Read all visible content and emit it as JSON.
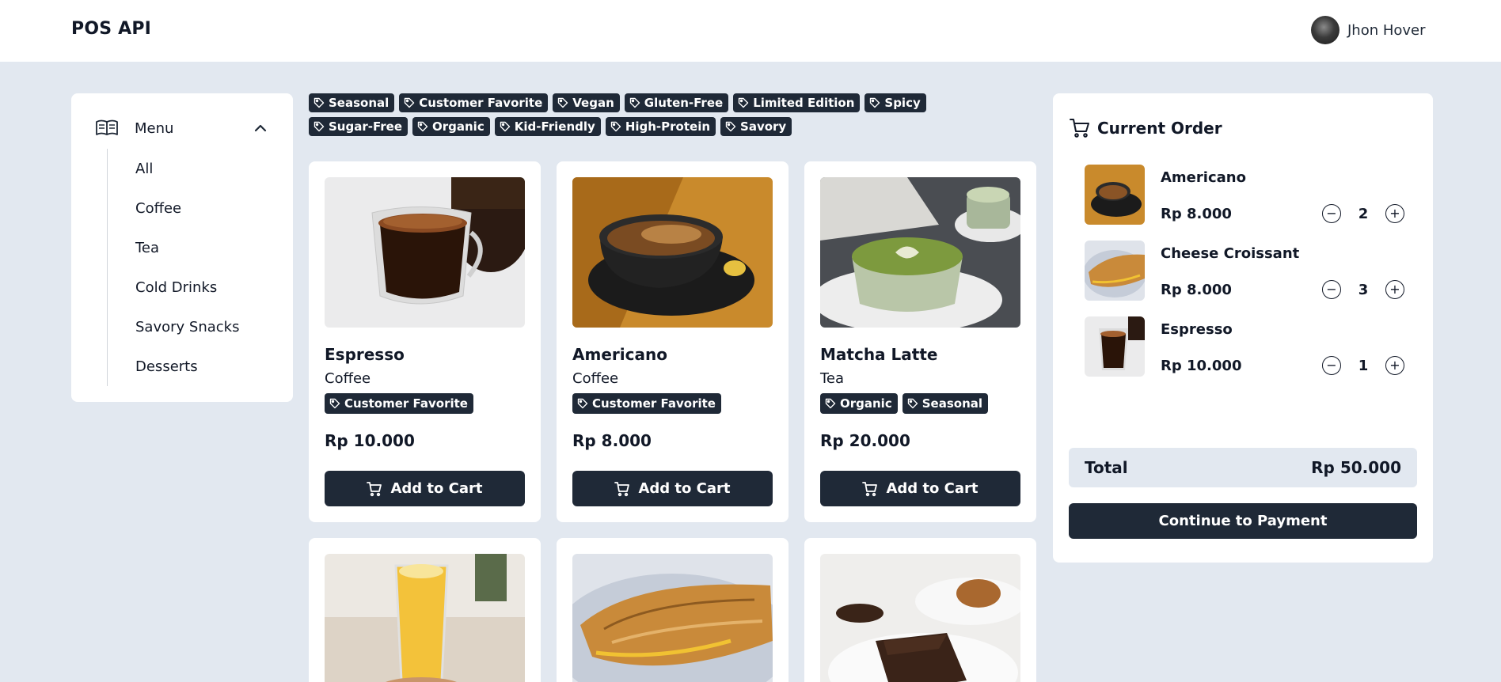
{
  "header": {
    "brand": "POS API",
    "user_name": "Jhon Hover"
  },
  "sidebar": {
    "title": "Menu",
    "items": [
      "All",
      "Coffee",
      "Tea",
      "Cold Drinks",
      "Savory Snacks",
      "Desserts"
    ]
  },
  "tag_filters": [
    "Seasonal",
    "Customer Favorite",
    "Vegan",
    "Gluten-Free",
    "Limited Edition",
    "Spicy",
    "Sugar-Free",
    "Organic",
    "Kid-Friendly",
    "High-Protein",
    "Savory"
  ],
  "products": [
    {
      "name": "Espresso",
      "category": "Coffee",
      "tags": [
        "Customer Favorite"
      ],
      "price": "Rp 10.000",
      "button": "Add to Cart"
    },
    {
      "name": "Americano",
      "category": "Coffee",
      "tags": [
        "Customer Favorite"
      ],
      "price": "Rp 8.000",
      "button": "Add to Cart"
    },
    {
      "name": "Matcha Latte",
      "category": "Tea",
      "tags": [
        "Organic",
        "Seasonal"
      ],
      "price": "Rp 20.000",
      "button": "Add to Cart"
    }
  ],
  "order": {
    "title": "Current Order",
    "items": [
      {
        "name": "Americano",
        "price": "Rp 8.000",
        "qty": "2"
      },
      {
        "name": "Cheese Croissant",
        "price": "Rp 8.000",
        "qty": "3"
      },
      {
        "name": "Espresso",
        "price": "Rp 10.000",
        "qty": "1"
      }
    ],
    "total_label": "Total",
    "total_value": "Rp 50.000",
    "pay_button": "Continue to Payment"
  },
  "colors": {
    "background": "#e2e8f0",
    "dark": "#1f2937",
    "card": "#ffffff"
  }
}
